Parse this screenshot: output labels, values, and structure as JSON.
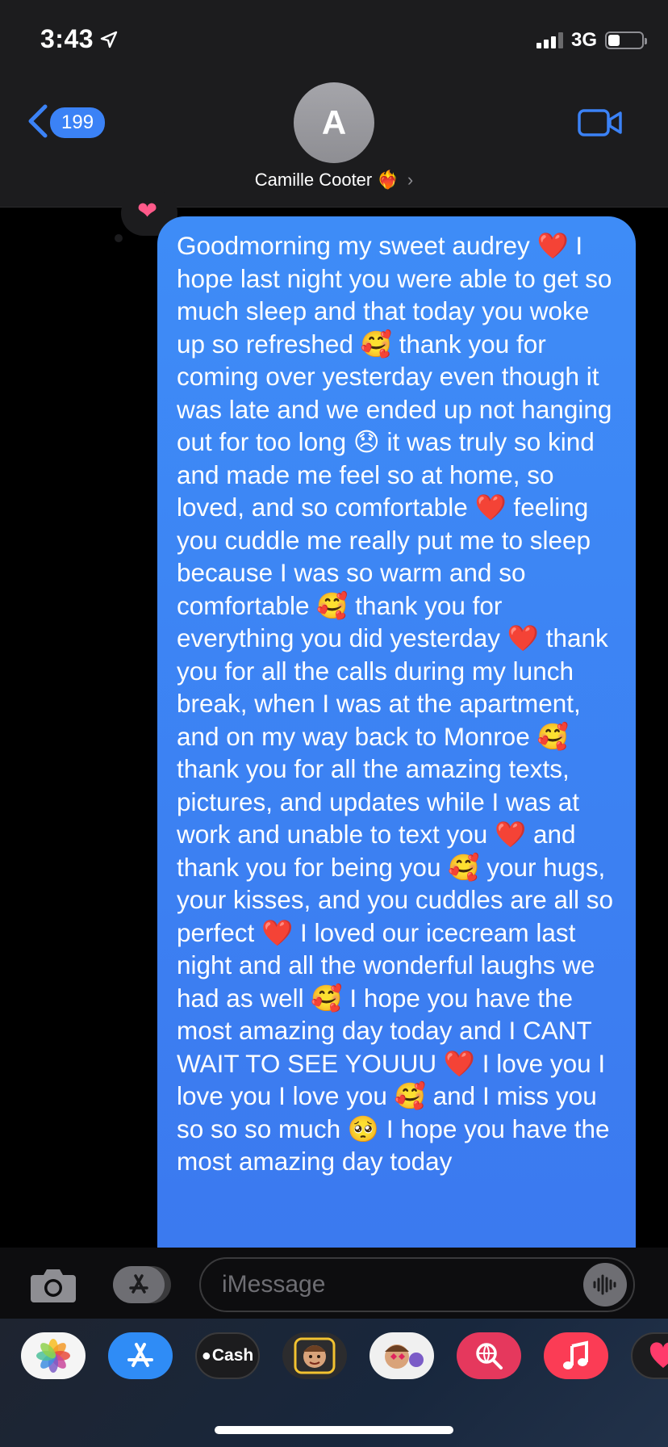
{
  "status_bar": {
    "time": "3:43",
    "network": "3G",
    "battery_level": 0.35
  },
  "nav": {
    "unread_count": "199",
    "avatar_initial": "A",
    "contact_name": "Camille Cooter",
    "name_emoji": "❤️‍🔥",
    "chevron": "›"
  },
  "message": {
    "tapback": "❤",
    "text": "Goodmorning my sweet audrey ❤️ I hope last night you were able to get so much sleep and that today you woke up so refreshed 🥰 thank you for coming over yesterday even though it was late and we ended up not hanging out for too long 😞 it was truly so kind and made me feel so at home, so loved, and so comfortable ❤️ feeling you cuddle me really put me to sleep because I was so warm and so comfortable 🥰 thank you for everything you did yesterday ❤️ thank you for all the calls during my lunch break, when I was at the apartment, and on my way back to Monroe 🥰 thank you for all the amazing texts, pictures, and updates while I was at work and unable to text you ❤️ and thank you for being you 🥰 your hugs, your kisses, and you cuddles are all so perfect ❤️ I loved our icecream last night and all the wonderful laughs we had as well 🥰 I hope you have the most amazing day today and I CANT WAIT TO SEE YOUUU ❤️ I love you I love you I love you 🥰 and I miss you so so so much 🥺 I hope you have the most amazing day today"
  },
  "input": {
    "placeholder": "iMessage"
  },
  "drawer": {
    "cash_label": "Cash",
    "apps": [
      "photos-icon",
      "app-store-icon",
      "apple-cash-icon",
      "memoji-icon",
      "memoji-stickers-icon",
      "web-search-icon",
      "music-icon",
      "heart-icon"
    ]
  },
  "colors": {
    "bubble": "#3b82f6",
    "header_bg": "#1c1c1e",
    "accent": "#3b82f6"
  }
}
